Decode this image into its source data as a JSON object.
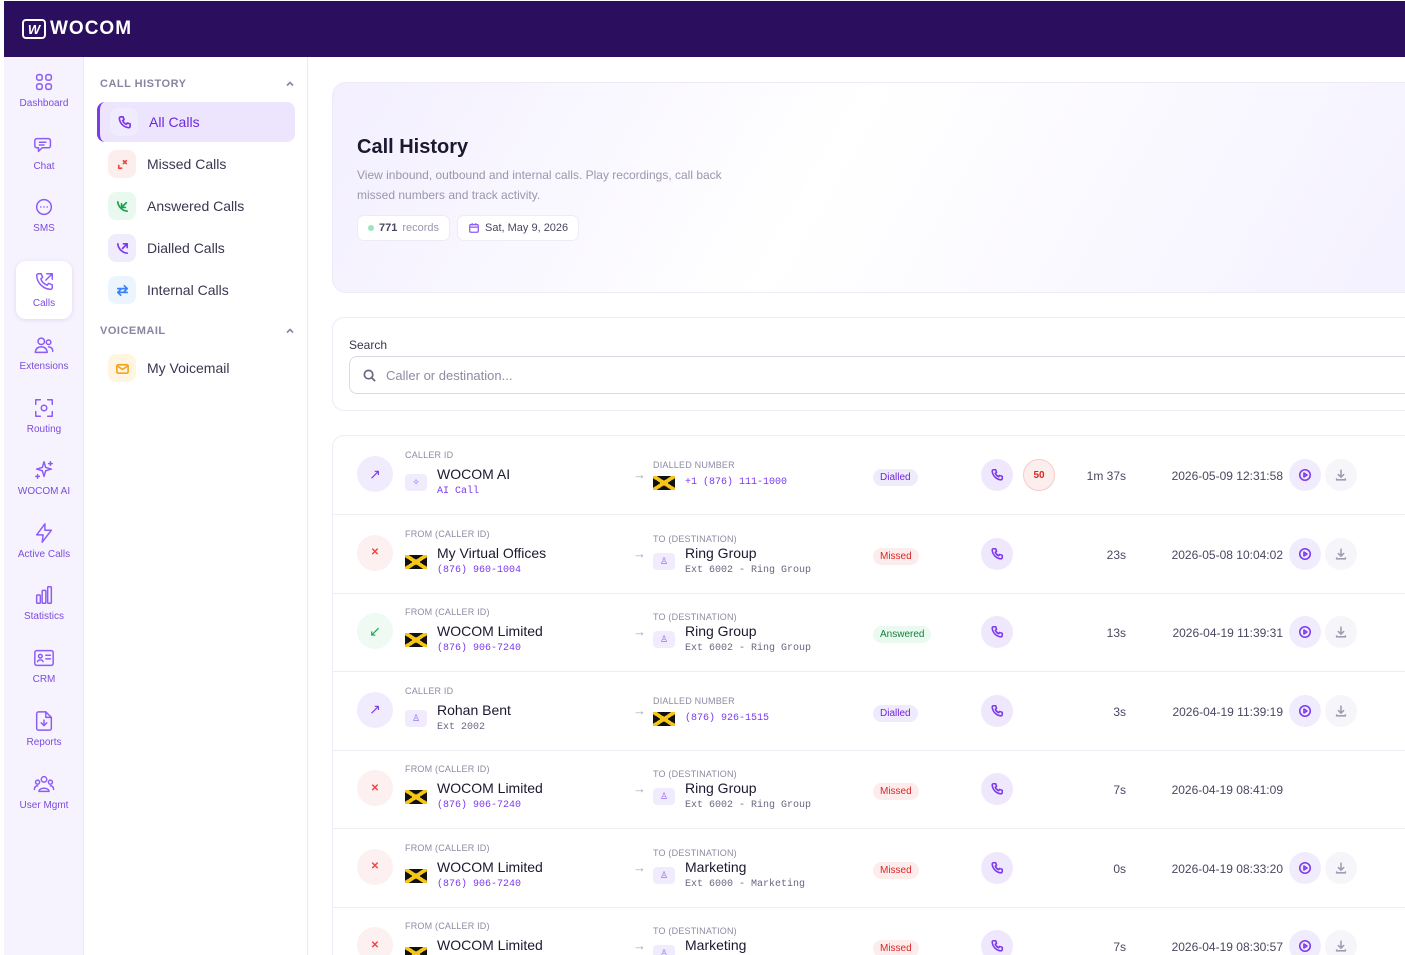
{
  "app": {
    "brand": "WOCOM"
  },
  "rail": [
    {
      "label": "Dashboard",
      "icon": "dashboard-icon"
    },
    {
      "label": "Chat",
      "icon": "chat-icon"
    },
    {
      "label": "SMS",
      "icon": "sms-icon"
    },
    {
      "label": "Calls",
      "icon": "calls-icon",
      "active": true
    },
    {
      "label": "Extensions",
      "icon": "extensions-icon"
    },
    {
      "label": "Routing",
      "icon": "routing-icon"
    },
    {
      "label": "WOCOM AI",
      "icon": "sparkles-icon"
    },
    {
      "label": "Active Calls",
      "icon": "lightning-icon"
    },
    {
      "label": "Statistics",
      "icon": "bar-chart-icon"
    },
    {
      "label": "CRM",
      "icon": "id-card-icon"
    },
    {
      "label": "Reports",
      "icon": "file-download-icon"
    },
    {
      "label": "User Mgmt",
      "icon": "users-icon"
    }
  ],
  "nav": {
    "call_history_title": "CALL HISTORY",
    "voicemail_title": "VOICEMAIL",
    "items": [
      {
        "label": "All Calls",
        "active": true
      },
      {
        "label": "Missed Calls"
      },
      {
        "label": "Answered Calls"
      },
      {
        "label": "Dialled Calls"
      },
      {
        "label": "Internal Calls"
      }
    ],
    "voicemail_items": [
      {
        "label": "My Voicemail"
      }
    ]
  },
  "hero": {
    "title": "Call History",
    "description": "View inbound, outbound and internal calls. Play recordings, call back missed numbers and track activity.",
    "record_count": "771",
    "record_label": "records",
    "date": "Sat, May 9, 2026"
  },
  "search": {
    "label": "Search",
    "placeholder": "Caller or destination..."
  },
  "calls": [
    {
      "dir": "out",
      "from_cap": "CALLER ID",
      "from_name": "WOCOM AI",
      "from_sub": "AI Call",
      "from_kind": "ai",
      "to_cap": "DIALLED NUMBER",
      "to_name": "",
      "to_sub": "+1 (876) 111-1000",
      "to_kind": "flag",
      "status": "Dialled",
      "score": "50",
      "duration": "1m 37s",
      "time": "2026-05-09 12:31:58",
      "recording": true
    },
    {
      "dir": "miss",
      "from_cap": "FROM (CALLER ID)",
      "from_name": "My Virtual Offices",
      "from_sub": "(876) 960-1004",
      "from_kind": "flag",
      "to_cap": "TO (DESTINATION)",
      "to_name": "Ring Group",
      "to_sub": "Ext 6002 - Ring Group",
      "to_kind": "user",
      "status": "Missed",
      "duration": "23s",
      "time": "2026-05-08 10:04:02",
      "recording": true
    },
    {
      "dir": "ans",
      "from_cap": "FROM (CALLER ID)",
      "from_name": "WOCOM Limited",
      "from_sub": "(876) 906-7240",
      "from_kind": "flag",
      "to_cap": "TO (DESTINATION)",
      "to_name": "Ring Group",
      "to_sub": "Ext 6002 - Ring Group",
      "to_kind": "user",
      "status": "Answered",
      "duration": "13s",
      "time": "2026-04-19 11:39:31",
      "recording": true
    },
    {
      "dir": "out",
      "from_cap": "CALLER ID",
      "from_name": "Rohan Bent",
      "from_sub": "Ext 2002",
      "from_kind": "user",
      "to_cap": "DIALLED NUMBER",
      "to_name": "",
      "to_sub": "(876) 926-1515",
      "to_kind": "flag",
      "status": "Dialled",
      "duration": "3s",
      "time": "2026-04-19 11:39:19",
      "recording": true
    },
    {
      "dir": "miss",
      "from_cap": "FROM (CALLER ID)",
      "from_name": "WOCOM Limited",
      "from_sub": "(876) 906-7240",
      "from_kind": "flag",
      "to_cap": "TO (DESTINATION)",
      "to_name": "Ring Group",
      "to_sub": "Ext 6002 - Ring Group",
      "to_kind": "user",
      "status": "Missed",
      "duration": "7s",
      "time": "2026-04-19 08:41:09",
      "recording": false
    },
    {
      "dir": "miss",
      "from_cap": "FROM (CALLER ID)",
      "from_name": "WOCOM Limited",
      "from_sub": "(876) 906-7240",
      "from_kind": "flag",
      "to_cap": "TO (DESTINATION)",
      "to_name": "Marketing",
      "to_sub": "Ext 6000 - Marketing",
      "to_kind": "user",
      "status": "Missed",
      "duration": "0s",
      "time": "2026-04-19 08:33:20",
      "recording": true
    },
    {
      "dir": "miss",
      "from_cap": "FROM (CALLER ID)",
      "from_name": "WOCOM Limited",
      "from_sub": "",
      "from_kind": "flag",
      "to_cap": "TO (DESTINATION)",
      "to_name": "Marketing",
      "to_sub": "",
      "to_kind": "user",
      "status": "Missed",
      "duration": "7s",
      "time": "2026-04-19 08:30:57",
      "recording": true
    }
  ],
  "colors": {
    "brand": "#2b0f5e",
    "accent": "#7c3aed",
    "missed": "#dc2626",
    "answered": "#15803d"
  }
}
